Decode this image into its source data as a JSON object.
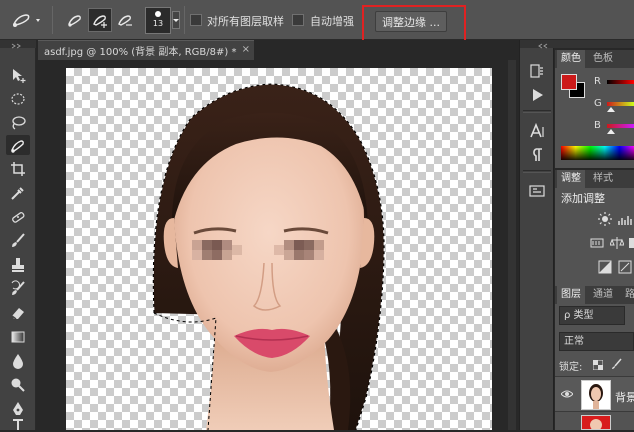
{
  "options_bar": {
    "brush_size": "13",
    "sample_all_layers_label": "对所有图层取样",
    "auto_enhance_label": "自动增强",
    "refine_edge_label": "调整边缘 ..."
  },
  "document": {
    "tab_title": "asdf.jpg @ 100% (背景 副本, RGB/8#) *",
    "close_glyph": "×"
  },
  "tools": [
    "move-tool",
    "marquee-tool",
    "lasso-tool",
    "quick-selection-tool",
    "crop-tool",
    "eyedropper-tool",
    "healing-brush-tool",
    "brush-tool",
    "clone-stamp-tool",
    "history-brush-tool",
    "eraser-tool",
    "gradient-tool",
    "blur-tool",
    "dodge-tool",
    "pen-tool",
    "type-tool"
  ],
  "color_panel": {
    "tab_active": "颜色",
    "tab_inactive": "色板",
    "r_label": "R",
    "g_label": "G",
    "b_label": "B",
    "foreground": "#cc1a1a",
    "background": "#000000"
  },
  "adjustments_panel": {
    "tab_active": "调整",
    "tab_inactive": "样式",
    "heading": "添加调整"
  },
  "layers_panel": {
    "tab_active": "图层",
    "tab_inactive": "通道",
    "tab_third": "路",
    "filter_kind": "ρ 类型",
    "blend_mode": "正常",
    "lock_label": "锁定:",
    "layer_name": "背景"
  }
}
